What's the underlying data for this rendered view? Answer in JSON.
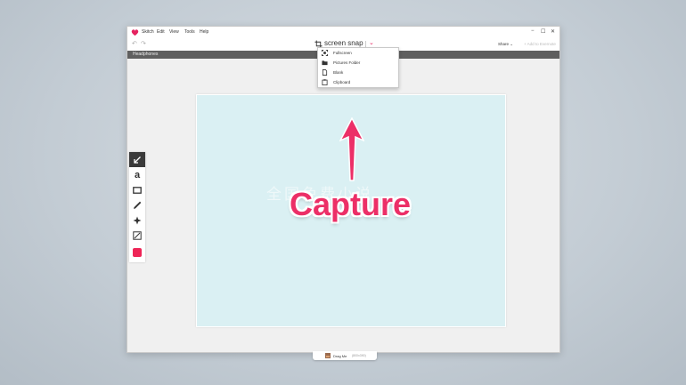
{
  "app": {
    "menu": [
      "Skitch",
      "Edit",
      "View",
      "Tools",
      "Help"
    ],
    "window_controls": [
      "−",
      "☐",
      "✕"
    ]
  },
  "toolbar": {
    "undo_glyph": "↶",
    "redo_glyph": "↷",
    "title": "screen snap",
    "chevron": "⌄",
    "share_label": "Share ⌄",
    "add_to_label": "+  Add to Evernote"
  },
  "tab": {
    "label": "Headphones"
  },
  "dropdown": {
    "items": [
      "Fullscreen",
      "Pictures Folder",
      "Blank",
      "Clipboard"
    ]
  },
  "canvas": {
    "watermark": "全国免费小说",
    "annotation_text": "Capture",
    "background_color": "#daf0f3",
    "annotation_color": "#ec2f67"
  },
  "sidetools": {
    "text_tool_label": "a",
    "selected_color": "#ee2557"
  },
  "dragbar": {
    "label": "Drag Me",
    "size": "(800x390)"
  },
  "colors": {
    "accent": "#e5225f",
    "tabbar": "#5f5f5f"
  }
}
